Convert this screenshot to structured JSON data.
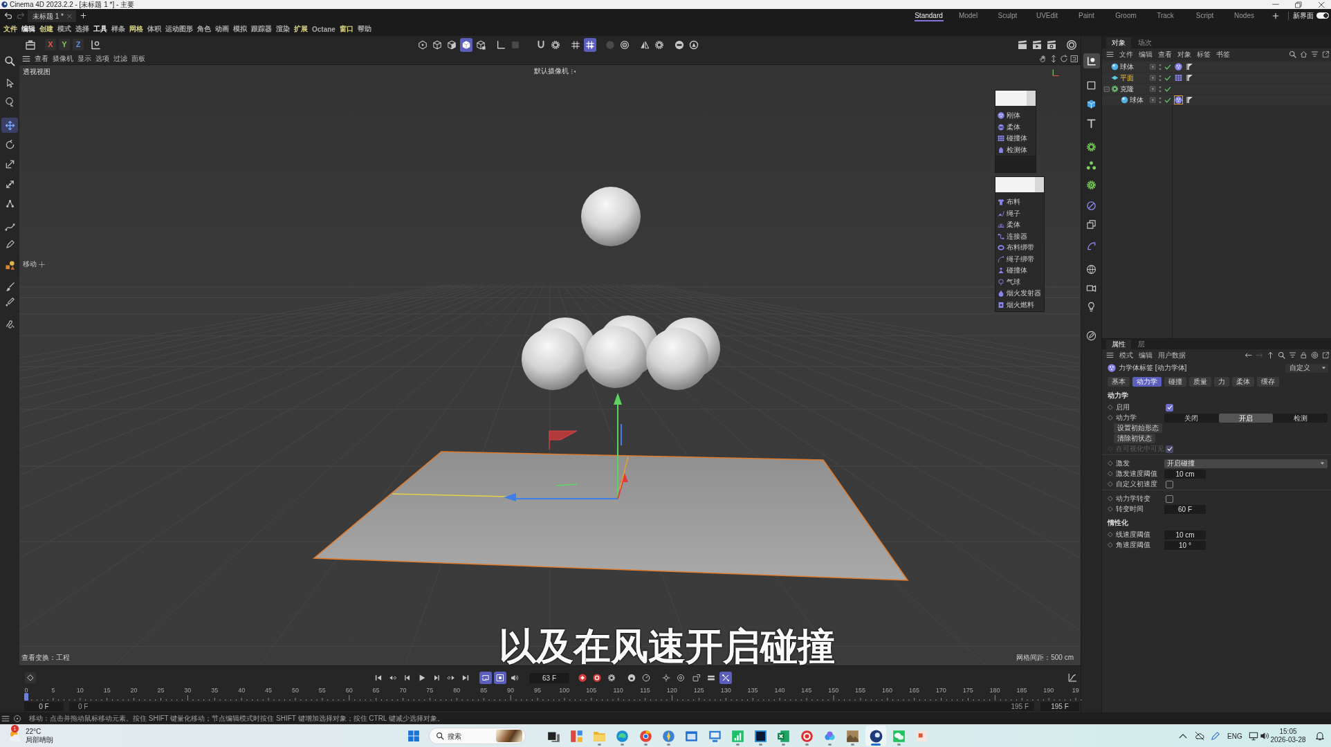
{
  "window": {
    "title": "Cinema 4D 2023.2.2 - [未标题 1 *] - 主要"
  },
  "document_tabs": [
    {
      "label": "未标题 1 *",
      "selected": true
    }
  ],
  "layouts": [
    {
      "label": "Standard",
      "selected": true
    },
    {
      "label": "Model",
      "selected": false
    },
    {
      "label": "Sculpt",
      "selected": false
    },
    {
      "label": "UVEdit",
      "selected": false
    },
    {
      "label": "Paint",
      "selected": false
    },
    {
      "label": "Groom",
      "selected": false
    },
    {
      "label": "Track",
      "selected": false
    },
    {
      "label": "Script",
      "selected": false
    },
    {
      "label": "Nodes",
      "selected": false
    }
  ],
  "new_layout": {
    "label": "新界面",
    "on": true
  },
  "menu": [
    {
      "label": "文件",
      "color": "#d9d27e"
    },
    {
      "label": "编辑",
      "color": "#f0f0f0"
    },
    {
      "label": "创建",
      "color": "#d9d27e"
    },
    {
      "label": "模式",
      "color": "#a9a9a9"
    },
    {
      "label": "选择",
      "color": "#a9a9a9"
    },
    {
      "label": "工具",
      "color": "#f0f0f0"
    },
    {
      "label": "样条",
      "color": "#a9a9a9"
    },
    {
      "label": "网格",
      "color": "#d9d27e"
    },
    {
      "label": "体积",
      "color": "#a9a9a9"
    },
    {
      "label": "运动图形",
      "color": "#a9a9a9"
    },
    {
      "label": "角色",
      "color": "#a9a9a9"
    },
    {
      "label": "动画",
      "color": "#a9a9a9"
    },
    {
      "label": "模拟",
      "color": "#a9a9a9"
    },
    {
      "label": "跟踪器",
      "color": "#a9a9a9"
    },
    {
      "label": "渲染",
      "color": "#a9a9a9"
    },
    {
      "label": "扩展",
      "color": "#d9d27e"
    },
    {
      "label": "Octane",
      "color": "#a9a9a9"
    },
    {
      "label": "窗口",
      "color": "#d9d27e"
    },
    {
      "label": "帮助",
      "color": "#a9a9a9"
    }
  ],
  "toolbar": {
    "axis_locks": [
      {
        "label": "X",
        "color": "#e2554c"
      },
      {
        "label": "Y",
        "color": "#86c65a"
      },
      {
        "label": "Z",
        "color": "#5a8fe2"
      }
    ],
    "mode_buttons": [
      {
        "selected": false
      },
      {
        "selected": false
      },
      {
        "selected": false
      },
      {
        "selected": true
      },
      {
        "selected": false
      },
      {
        "selected": false
      },
      {
        "selected": false
      },
      {
        "selected": false
      },
      {
        "selected": false
      },
      {
        "selected": false
      },
      {
        "selected": true
      },
      {
        "selected": false
      },
      {
        "selected": false
      },
      {
        "selected": false
      },
      {
        "selected": false
      },
      {
        "selected": false
      },
      {
        "selected": false
      }
    ]
  },
  "tools": [
    {
      "selected": false
    },
    {
      "selected": false
    },
    {
      "selected": true
    },
    {
      "selected": false
    },
    {
      "selected": false
    },
    {
      "selected": false
    },
    {
      "selected": false
    },
    {
      "selected": false
    },
    {
      "selected": false
    },
    {
      "selected": false
    },
    {
      "selected": false
    },
    {
      "selected": false
    },
    {
      "selected": false
    }
  ],
  "object_tools": [
    {
      "selected": true
    },
    {
      "selected": false
    },
    {
      "selected": false
    },
    {
      "selected": false
    },
    {
      "selected": false
    },
    {
      "selected": false
    },
    {
      "selected": false
    },
    {
      "selected": false
    },
    {
      "selected": false
    },
    {
      "selected": false
    },
    {
      "selected": false
    },
    {
      "selected": false
    },
    {
      "selected": false
    },
    {
      "selected": false
    }
  ],
  "viewport": {
    "menu": [
      "查看",
      "摄像机",
      "显示",
      "选项",
      "过滤",
      "面板"
    ],
    "view_name": "透视视图",
    "camera": "默认摄像机",
    "active_tool": "移动",
    "view_transform": "查看变换：工程",
    "grid_spacing": "网格间距：500 cm",
    "subtitle": "以及在风速开启碰撞"
  },
  "dynamics_palette": [
    {
      "items": [
        "刚体",
        "柔体",
        "碰撞体",
        "检测体"
      ]
    },
    {
      "items": [
        "布料",
        "绳子",
        "柔体",
        "连接器",
        "布料绑带",
        "绳子绑带",
        "碰撞体",
        "气球",
        "烟火发射器",
        "烟火燃料"
      ]
    }
  ],
  "object_manager": {
    "tabs": [
      {
        "label": "对象",
        "selected": true
      },
      {
        "label": "场次",
        "selected": false
      }
    ],
    "menu": [
      "文件",
      "编辑",
      "查看",
      "对象",
      "标签",
      "书签"
    ],
    "objects": [
      {
        "name": "球体",
        "kind": "sphere",
        "selected": false,
        "enabled": true,
        "tags": [
          {
            "kind": "rigid-body",
            "selected": false
          },
          {
            "kind": "phong",
            "selected": false
          }
        ]
      },
      {
        "name": "平面",
        "kind": "plane",
        "selected": true,
        "enabled": true,
        "tags": [
          {
            "kind": "collider",
            "selected": false
          },
          {
            "kind": "phong",
            "selected": false
          }
        ]
      },
      {
        "name": "克隆",
        "kind": "cloner",
        "selected": false,
        "enabled": true,
        "expanded": true,
        "children": [
          {
            "name": "球体",
            "kind": "sphere",
            "selected": false,
            "enabled": true,
            "tags": [
              {
                "kind": "rigid-body",
                "selected": true
              },
              {
                "kind": "phong",
                "selected": false
              }
            ]
          }
        ]
      }
    ]
  },
  "attributes": {
    "tabs": [
      {
        "label": "属性",
        "selected": true
      },
      {
        "label": "层",
        "selected": false
      }
    ],
    "menu": [
      "模式",
      "编辑",
      "用户数据"
    ],
    "title": "力学体标签 [动力学体]",
    "preset": "自定义",
    "page_tabs": [
      {
        "label": "基本",
        "selected": false
      },
      {
        "label": "动力学",
        "selected": true
      },
      {
        "label": "碰撞",
        "selected": false
      },
      {
        "label": "质量",
        "selected": false
      },
      {
        "label": "力",
        "selected": false
      },
      {
        "label": "柔体",
        "selected": false
      },
      {
        "label": "缓存",
        "selected": false
      }
    ],
    "sections": [
      {
        "title": "动力学",
        "groups": [
          {
            "rows": [
              {
                "kind": "checkbox",
                "label": "启用",
                "checked": true,
                "disabled": false
              },
              {
                "kind": "segmented",
                "label": "动力学",
                "disabled": false,
                "options": [
                  {
                    "label": "关闭",
                    "selected": false
                  },
                  {
                    "label": "开启",
                    "selected": true
                  },
                  {
                    "label": "检测",
                    "selected": false
                  }
                ]
              },
              {
                "kind": "button",
                "label": "设置初始形态",
                "disabled": false
              },
              {
                "kind": "button",
                "label": "清除初状态",
                "disabled": false
              },
              {
                "kind": "checkbox",
                "label": "在可视化中可见",
                "checked": true,
                "disabled": true
              }
            ]
          },
          {
            "rows": [
              {
                "kind": "dropdown",
                "label": "激发",
                "value": "开启碰撞",
                "disabled": false
              },
              {
                "kind": "field",
                "label": "激发速度阈值",
                "value": "10 cm",
                "disabled": false
              },
              {
                "kind": "checkbox",
                "label": "自定义初速度",
                "checked": false,
                "disabled": false
              }
            ]
          },
          {
            "rows": [
              {
                "kind": "checkbox",
                "label": "动力学转变",
                "checked": false,
                "disabled": false
              },
              {
                "kind": "field",
                "label": "转变时间",
                "value": "60 F",
                "disabled": false
              }
            ]
          }
        ]
      },
      {
        "title": "惰性化",
        "groups": [
          {
            "rows": [
              {
                "kind": "field",
                "label": "线速度阈值",
                "value": "10 cm",
                "disabled": false
              },
              {
                "kind": "field",
                "label": "角速度阈值",
                "value": "10 °",
                "disabled": false
              }
            ]
          }
        ]
      }
    ]
  },
  "timeline": {
    "controls": [
      {
        "selected": false
      },
      {
        "selected": false
      },
      {
        "selected": false
      },
      {
        "selected": false
      },
      {
        "selected": false
      },
      {
        "selected": false
      },
      {
        "selected": false
      },
      {
        "selected": true
      },
      {
        "selected": true
      },
      {
        "selected": false
      },
      {
        "selected": false
      },
      {
        "selected": false
      },
      {
        "selected": false
      },
      {
        "selected": false
      },
      {
        "selected": false
      },
      {
        "selected": false
      },
      {
        "selected": false
      },
      {
        "selected": false
      },
      {
        "selected": false
      },
      {
        "selected": true
      }
    ],
    "current_frame": "63 F",
    "ruler": [
      "0",
      "5",
      "10",
      "15",
      "20",
      "25",
      "30",
      "35",
      "40",
      "45",
      "50",
      "55",
      "60",
      "65",
      "70",
      "75",
      "80",
      "85",
      "90",
      "95",
      "100",
      "105",
      "110",
      "115",
      "120",
      "125",
      "130",
      "135",
      "140",
      "145",
      "150",
      "155",
      "160",
      "165",
      "170",
      "175",
      "180",
      "185",
      "190",
      "19"
    ],
    "playhead": {
      "level": 0
    },
    "start_frame": "0 F",
    "range_start": "0 F",
    "range_end": "195 F",
    "end_frame": "195 F"
  },
  "status_bar": {
    "message": "移动：点击并拖动鼠标移动元素。按住 SHIFT 键量化移动；节点编辑模式时按住 SHIFT 键增加选择对象；按住 CTRL 键减少选择对象。"
  },
  "taskbar": {
    "weather": {
      "alerts": "1",
      "temperature": "22°C",
      "condition": "局部晴朗"
    },
    "search": {
      "placeholder": "搜索"
    },
    "apps": [
      {
        "running": false,
        "active": false
      },
      {
        "running": false,
        "active": false
      },
      {
        "running": true,
        "active": false
      },
      {
        "running": true,
        "active": false
      },
      {
        "running": true,
        "active": false
      },
      {
        "running": true,
        "active": false
      },
      {
        "running": false,
        "active": false
      },
      {
        "running": false,
        "active": false
      },
      {
        "running": true,
        "active": false
      },
      {
        "running": true,
        "active": false
      },
      {
        "running": true,
        "active": false
      },
      {
        "running": true,
        "active": false
      },
      {
        "running": true,
        "active": false
      },
      {
        "running": true,
        "active": false
      },
      {
        "running": true,
        "active": true
      },
      {
        "running": true,
        "active": false
      },
      {
        "running": false,
        "active": false
      }
    ],
    "language": "ENG",
    "time": "15:05",
    "date": "2026-03-28"
  }
}
